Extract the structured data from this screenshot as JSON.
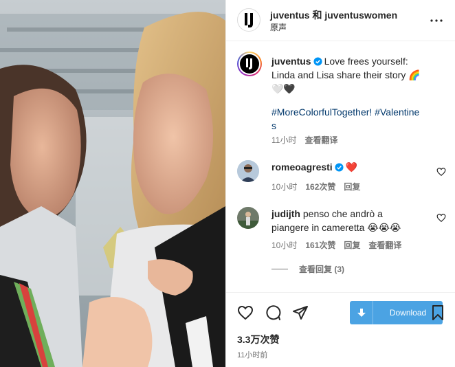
{
  "header": {
    "title": "juventus 和 juventuswomen",
    "subtitle": "原声"
  },
  "caption": {
    "username": "juventus",
    "text_line1": "Love frees yourself:",
    "text_line2": "Linda and Lisa share their story 🌈",
    "text_line3": "🤍🖤",
    "hashtags_line1": "#MoreColorfulTogether! #Valentine",
    "hashtags_line2": "s",
    "time": "11小时",
    "see_translation": "查看翻译"
  },
  "comments": [
    {
      "username": "romeoagresti",
      "text": "❤️",
      "time": "10小时",
      "likes": "162次赞",
      "reply": "回复"
    },
    {
      "username": "judijth",
      "text_line1": "penso che andrò a",
      "text_line2": "piangere in cameretta 😭😭😭",
      "time": "10小时",
      "likes": "161次赞",
      "reply": "回复",
      "see_translation": "查看翻译"
    }
  ],
  "view_replies": "查看回复 (3)",
  "actions": {
    "download_label": "Download",
    "likes_count": "3.3万次赞",
    "posted_ago": "11小时前"
  },
  "colors": {
    "verified": "#0095f6",
    "hashtag": "#00376b",
    "download": "#4ba3e3",
    "heart_red": "#ed1c2a"
  },
  "icons": [
    "more-icon",
    "verified-icon",
    "heart-icon",
    "comment-icon",
    "share-icon",
    "download-icon",
    "bookmark-icon"
  ]
}
